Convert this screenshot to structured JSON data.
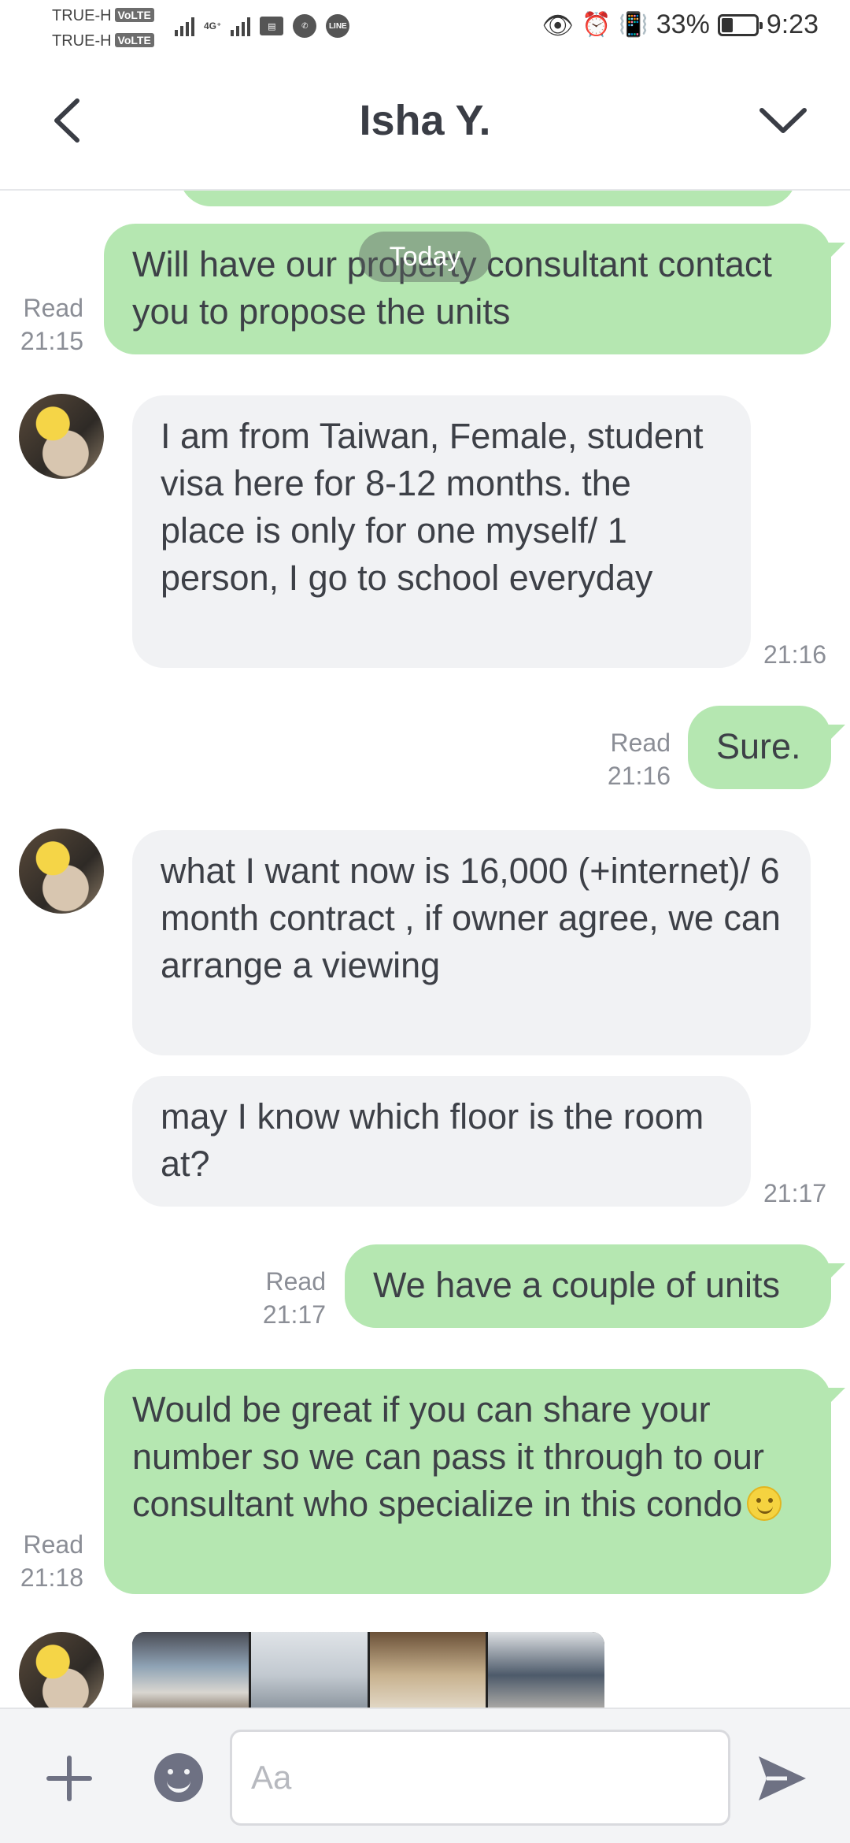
{
  "status_bar": {
    "sim1": "TRUE-H",
    "sim2": "TRUE-H",
    "volte": "VoLTE",
    "network": "4G⁺",
    "battery_percent": "33%",
    "battery_level": 0.33,
    "time": "9:23"
  },
  "header": {
    "contact_name": "Isha Y."
  },
  "chat": {
    "date_divider": "Today",
    "messages": [
      {
        "text": "Will have our property consultant contact you to propose the units",
        "read": "Read",
        "time": "21:15"
      },
      {
        "text": "I am from Taiwan, Female, student visa here for 8-12 months. the place is only for one myself/ 1 person, I go to school everyday",
        "time": "21:16"
      },
      {
        "text": "Sure.",
        "read": "Read",
        "time": "21:16"
      },
      {
        "text": "what I want now is 16,000 (+internet)/ 6 month contract , if owner agree, we can arrange a viewing"
      },
      {
        "text": "may I know which floor is the room at?",
        "time": "21:17"
      },
      {
        "text": "We have a couple of units",
        "read": "Read",
        "time": "21:17"
      },
      {
        "text": "Would be great if you can share your number so we can pass it through to our consultant who specialize in this condo",
        "read": "Read",
        "time": "21:18"
      }
    ]
  },
  "input_bar": {
    "placeholder": "Aa"
  },
  "colors": {
    "outgoing_bubble": "#b5e7b1",
    "incoming_bubble": "#f1f2f4",
    "icon": "#6e7183"
  }
}
